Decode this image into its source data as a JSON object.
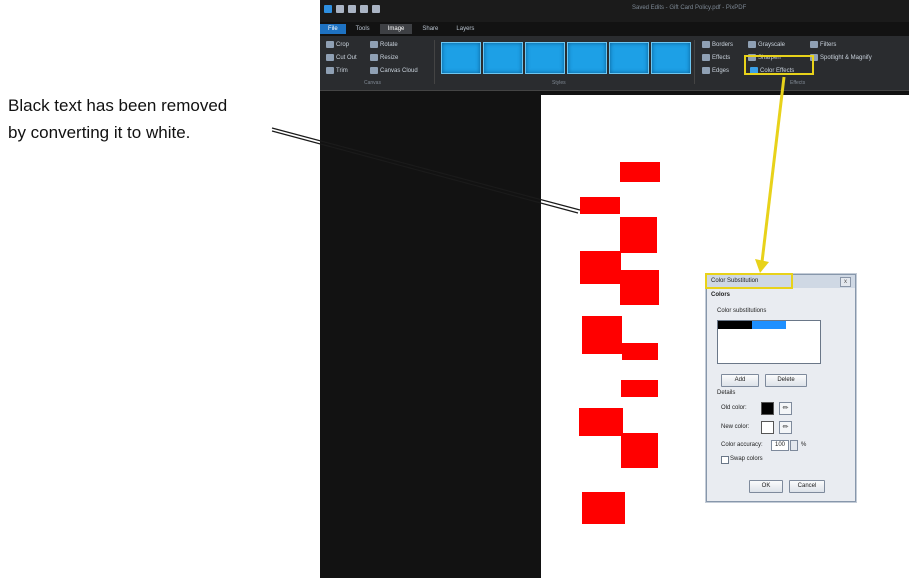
{
  "annotation": {
    "line1": "Black text has been removed",
    "line2": "by converting it to white."
  },
  "window": {
    "title": "Saved Edits - Gift Card Policy.pdf - PixPDF"
  },
  "tabs": [
    "File",
    "Tools",
    "Image",
    "Share",
    "Layers"
  ],
  "ribbon": {
    "canvas_group": {
      "label": "Canvas",
      "items": [
        "Crop",
        "Rotate",
        "Cut Out",
        "Resize",
        "Trim",
        "Canvas Cloud"
      ]
    },
    "styles_group": {
      "label": "Styles"
    },
    "effects_group": {
      "label": "Effects",
      "items": [
        "Borders",
        "Grayscale",
        "Filters",
        "Effects",
        "Sharpen",
        "Spotlight & Magnify",
        "Edges",
        "Color Effects"
      ]
    }
  },
  "dialog": {
    "title": "Color Substitution",
    "close": "x",
    "group_label": "Colors",
    "list_label": "Color substitutions",
    "colors": {
      "black": "#000000",
      "blue": "#1e90ff",
      "white": "#ffffff"
    },
    "add_button": "Add",
    "delete_button": "Delete",
    "details_label": "Details",
    "old_color_label": "Old color:",
    "new_color_label": "New color:",
    "accuracy_label": "Color accuracy:",
    "accuracy_value": "100",
    "accuracy_unit": "%",
    "swap_label": "Swap colors",
    "ok_button": "OK",
    "cancel_button": "Cancel"
  },
  "colors": {
    "redaction": "#ff0000",
    "highlight": "#e8d21a",
    "app_background": "#121212"
  }
}
